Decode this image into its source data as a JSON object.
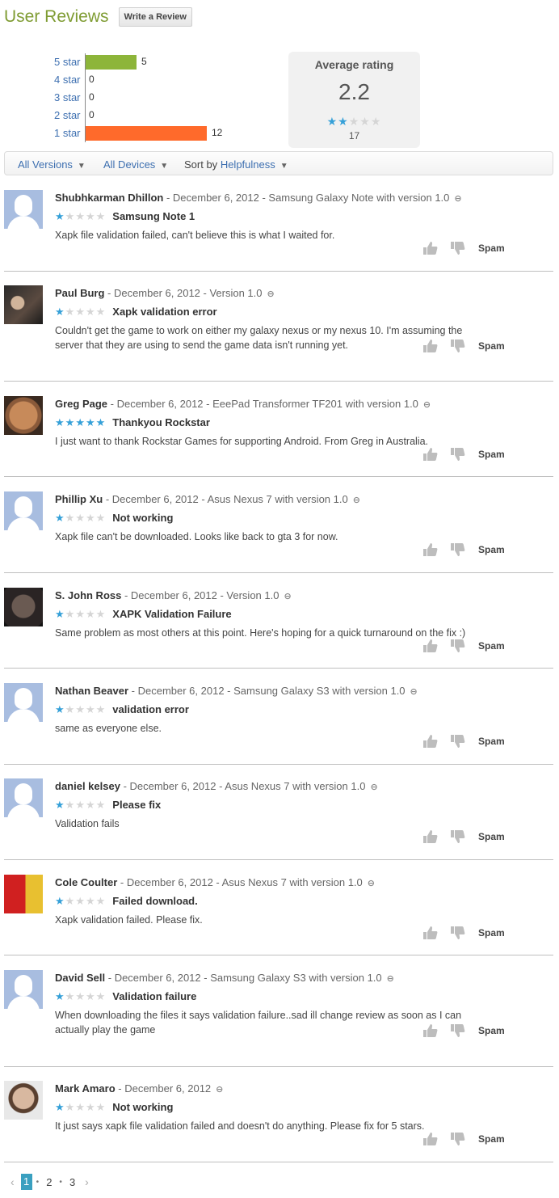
{
  "header": {
    "title": "User Reviews",
    "write_button": "Write a Review"
  },
  "histogram": [
    {
      "label": "5 star",
      "count": "5",
      "value": 5,
      "color": "#8db53a"
    },
    {
      "label": "4 star",
      "count": "0",
      "value": 0,
      "color": "#8db53a"
    },
    {
      "label": "3 star",
      "count": "0",
      "value": 0,
      "color": "#8db53a"
    },
    {
      "label": "2 star",
      "count": "0",
      "value": 0,
      "color": "#8db53a"
    },
    {
      "label": "1 star",
      "count": "12",
      "value": 12,
      "color": "#ff6a2b"
    }
  ],
  "average": {
    "label": "Average rating",
    "value": "2.2",
    "stars": 2,
    "count": "17"
  },
  "filters": {
    "versions": "All Versions",
    "devices": "All Devices",
    "sort_prefix": "Sort by",
    "sort_value": "Helpfulness"
  },
  "reviews": [
    {
      "author": "Shubhkarman Dhillon",
      "meta": " - December 6, 2012 - Samsung Galaxy Note with version 1.0",
      "stars": 1,
      "title": "Samsung Note 1",
      "body": "Xapk file validation failed, can't believe this is what I waited for.",
      "avatar": "default",
      "spam": "Spam"
    },
    {
      "author": "Paul Burg",
      "meta": " - December 6, 2012 - Version 1.0",
      "stars": 1,
      "title": "Xapk validation error",
      "body": "Couldn't get the game to work on either my galaxy nexus or my nexus 10. I'm assuming the server that they are using to send the game data isn't running yet.",
      "avatar": "photo",
      "spam": "Spam"
    },
    {
      "author": "Greg Page",
      "meta": " - December 6, 2012 - EeePad Transformer TF201 with version 1.0",
      "stars": 5,
      "title": "Thankyou Rockstar",
      "body": "I just want to thank Rockstar Games for supporting Android. From Greg in Australia.",
      "avatar": "photo",
      "spam": "Spam"
    },
    {
      "author": "Phillip Xu",
      "meta": " - December 6, 2012 - Asus Nexus 7 with version 1.0",
      "stars": 1,
      "title": "Not working",
      "body": "Xapk file can't be downloaded. Looks like back to gta 3 for now.",
      "avatar": "default",
      "spam": "Spam"
    },
    {
      "author": "S. John Ross",
      "meta": " - December 6, 2012 - Version 1.0",
      "stars": 1,
      "title": "XAPK Validation Failure",
      "body": "Same problem as most others at this point. Here's hoping for a quick turnaround on the fix :)",
      "avatar": "photo",
      "spam": "Spam"
    },
    {
      "author": "Nathan Beaver",
      "meta": " - December 6, 2012 - Samsung Galaxy S3 with version 1.0",
      "stars": 1,
      "title": "validation error",
      "body": "same as everyone else.",
      "avatar": "default",
      "spam": "Spam"
    },
    {
      "author": "daniel kelsey",
      "meta": " - December 6, 2012 - Asus Nexus 7 with version 1.0",
      "stars": 1,
      "title": "Please fix",
      "body": "Validation fails",
      "avatar": "default",
      "spam": "Spam"
    },
    {
      "author": "Cole Coulter",
      "meta": " - December 6, 2012 - Asus Nexus 7 with version 1.0",
      "stars": 1,
      "title": "Failed download.",
      "body": "Xapk validation failed. Please fix.",
      "avatar": "photo",
      "spam": "Spam"
    },
    {
      "author": "David Sell",
      "meta": " - December 6, 2012 - Samsung Galaxy S3 with version 1.0",
      "stars": 1,
      "title": "Validation failure",
      "body": "When downloading the files it says validation failure..sad ill change review as soon as I can actually play the game",
      "avatar": "default",
      "spam": "Spam"
    },
    {
      "author": "Mark Amaro",
      "meta": " - December 6, 2012",
      "stars": 1,
      "title": "Not working",
      "body": "It just says xapk file validation failed and doesn't do anything. Please fix for 5 stars.",
      "avatar": "photo",
      "spam": "Spam"
    }
  ],
  "pagination": {
    "pages": [
      "1",
      "2",
      "3"
    ],
    "current": "1"
  },
  "colors": {
    "accent": "#7f9c33",
    "link": "#3d6fb0",
    "star": "#35a0d8"
  }
}
